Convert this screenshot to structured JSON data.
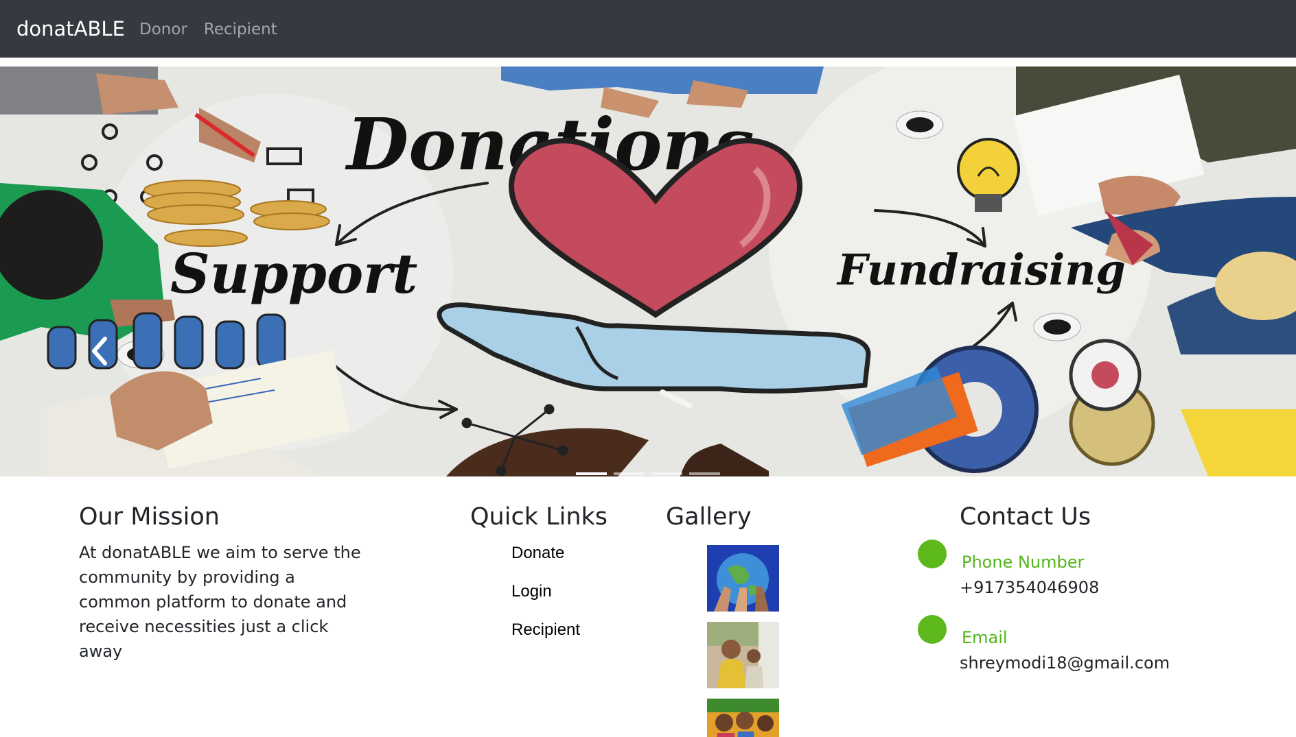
{
  "navbar": {
    "brand": "donatABLE",
    "links": [
      "Donor",
      "Recipient"
    ]
  },
  "carousel": {
    "heading": "Donations",
    "left_word": "Support",
    "right_word": "Fundraising",
    "indicator_count": 4,
    "active_index": 0,
    "prev_icon": "chevron-left-icon"
  },
  "mission": {
    "title": "Our Mission",
    "text": "At donatABLE we aim to serve the community by providing a common platform to donate and receive necessities just a click away"
  },
  "quick_links": {
    "title": "Quick Links",
    "items": [
      "Donate",
      "Login",
      "Recipient"
    ]
  },
  "gallery": {
    "title": "Gallery"
  },
  "contact": {
    "title": "Contact Us",
    "phone_label": "Phone Number",
    "phone_value": "+917354046908",
    "email_label": "Email",
    "email_value": "shreymodi18@gmail.com"
  },
  "colors": {
    "navbar_bg": "#343a40",
    "accent_green": "#5cb81b",
    "heart_red": "#c44a5d"
  }
}
